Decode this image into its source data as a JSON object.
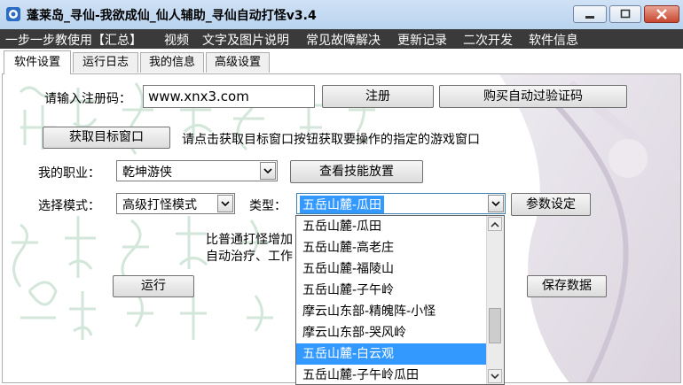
{
  "window": {
    "title": "蓬莱岛_寻仙-我欲成仙_仙人辅助_寻仙自动打怪v3.4"
  },
  "menu": {
    "items": [
      "一步一步教使用【汇总】",
      "视频",
      "文字及图片说明",
      "常见故障解决",
      "更新记录",
      "二次开发",
      "软件信息"
    ]
  },
  "tabs": [
    "软件设置",
    "运行日志",
    "我的信息",
    "高级设置"
  ],
  "settings": {
    "reg_label": "请输入注册码：",
    "reg_value": "www.xnx3.com",
    "register_button": "注册",
    "buy_button": "购买自动过验证码",
    "get_window_button": "获取目标窗口",
    "get_window_hint": "请点击获取目标窗口按钮获取要操作的指定的游戏窗口",
    "profession_label": "我的职业：",
    "profession_value": "乾坤游侠",
    "skills_button": "查看技能放置",
    "mode_label": "选择模式：",
    "mode_value": "高级打怪模式",
    "type_label": "类型：",
    "type_value": "五岳山麓-瓜田",
    "params_button": "参数设定",
    "desc_line1": "比普通打怪增加",
    "desc_line2": "自动治疗、工作",
    "run_button": "运行",
    "save_button": "保存数据"
  },
  "type_dropdown": {
    "options": [
      "五岳山麓-瓜田",
      "五岳山麓-高老庄",
      "五岳山麓-福陵山",
      "五岳山麓-子午岭",
      "摩云山东部-精魄阵-小怪",
      "摩云山东部-哭风岭",
      "五岳山麓-白云观",
      "五岳山麓-子午岭瓜田"
    ],
    "highlighted": "五岳山麓-白云观"
  },
  "colors": {
    "menubar_bg": "#3a3a3a",
    "selection": "#3399ff",
    "titlebar": "#c4daf2",
    "close_button": "#c7462f"
  }
}
